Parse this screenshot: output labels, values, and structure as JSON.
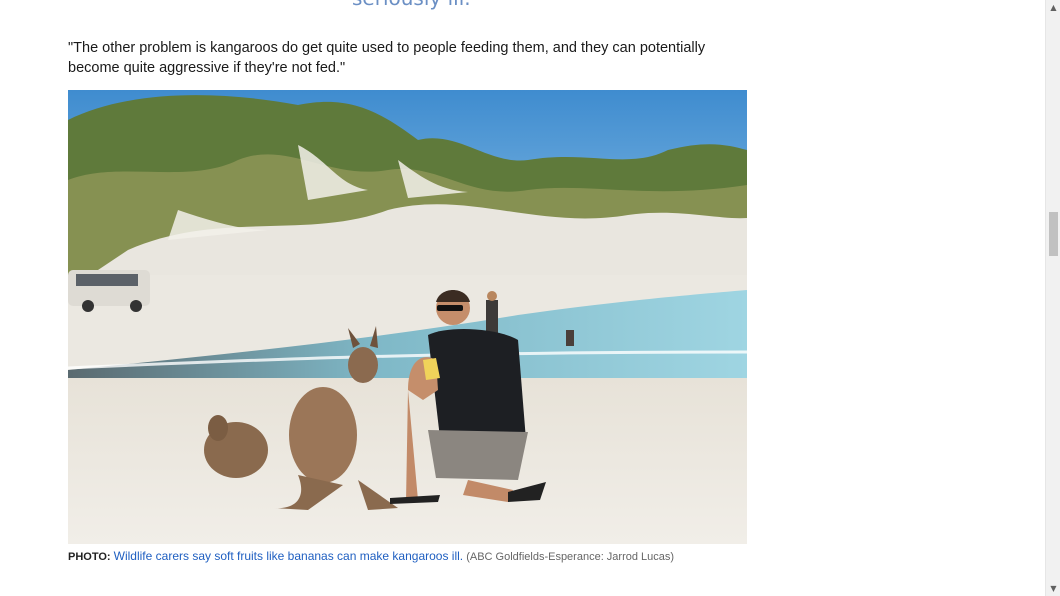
{
  "article": {
    "pullquote_tail": "seriously ill.",
    "quote_paragraph": "\"The other problem is kangaroos do get quite used to people feeding them, and they can potentially become quite aggressive if they're not fed.\"",
    "photo": {
      "alt": "Man feeding banana to kangaroos on a white sand beach",
      "caption_label": "PHOTO:",
      "caption_link": "Wildlife carers say soft fruits like bananas can make kangaroos ill.",
      "caption_credit": "(ABC Goldfields-Esperance: Jarrod Lucas)"
    }
  },
  "scrollbar": {
    "up_icon": "triangle-up",
    "down_icon": "triangle-down"
  },
  "colors": {
    "link": "#1f5fc1",
    "pullquote": "#6b8fc4",
    "sky": "#4f97d4",
    "sand": "#ece9e2",
    "water": "#7fc3d6"
  }
}
